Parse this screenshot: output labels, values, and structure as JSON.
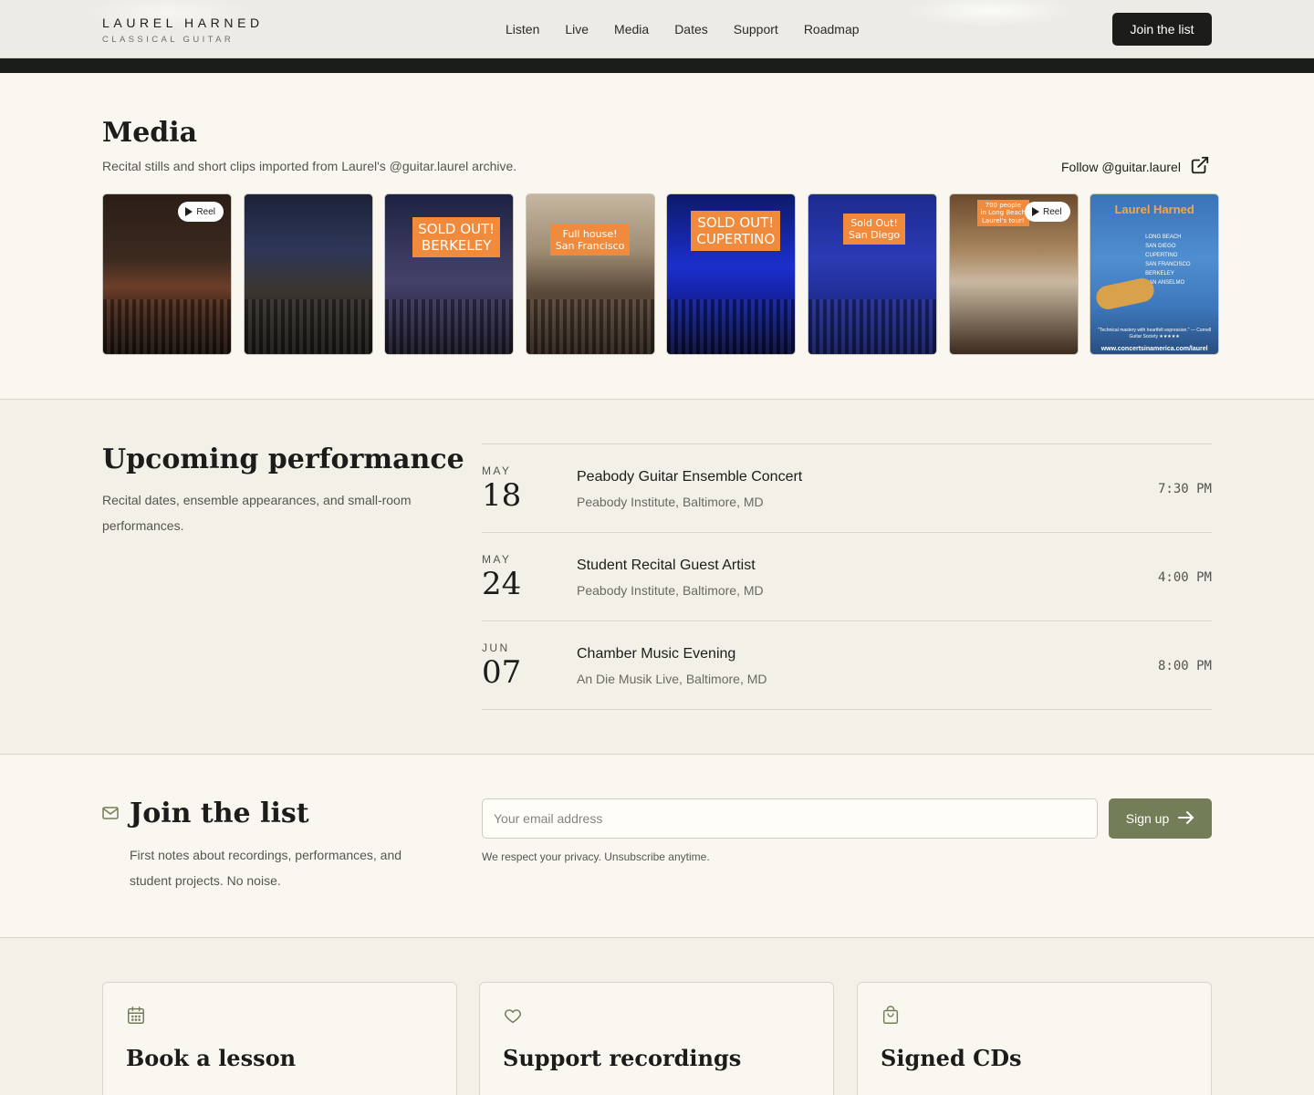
{
  "header": {
    "brand_name": "LAUREL HARNED",
    "brand_sub": "CLASSICAL GUITAR",
    "nav": [
      "Listen",
      "Live",
      "Media",
      "Dates",
      "Support",
      "Roadmap"
    ],
    "cta": "Join the list"
  },
  "media": {
    "title": "Media",
    "subtitle": "Recital stills and short clips imported from Laurel's @guitar.laurel archive.",
    "follow": "Follow @guitar.laurel",
    "reel_label": "Reel",
    "tiles": [
      {
        "tag": ""
      },
      {
        "tag": ""
      },
      {
        "tag_line1": "SOLD OUT!",
        "tag_line2": "BERKELEY"
      },
      {
        "tag_line1": "Full house!",
        "tag_line2": "San Francisco"
      },
      {
        "tag_line1": "SOLD OUT!",
        "tag_line2": "CUPERTINO"
      },
      {
        "tag_line1": "Sold Out!",
        "tag_line2": "San Diego"
      },
      {
        "tag_line1": "700 people",
        "tag_line2": "in Long Beach",
        "tag_line3": "Laurel's tour!"
      },
      {
        "poster_title": "Laurel Harned",
        "poster_list": [
          "LONG BEACH",
          "SAN DIEGO",
          "CUPERTINO",
          "SAN FRANCISCO",
          "BERKELEY",
          "SAN ANSELMO"
        ],
        "poster_quote": "\"Technical mastery with heartfelt expression.\" — Cornell Guitar Society ★★★★★",
        "poster_url": "www.concertsinamerica.com/laurel"
      }
    ]
  },
  "upcoming": {
    "title": "Upcoming performance",
    "description": "Recital dates, ensemble appearances, and small-room performances.",
    "events": [
      {
        "month": "MAY",
        "day": "18",
        "name": "Peabody Guitar Ensemble Concert",
        "venue": "Peabody Institute, Baltimore, MD",
        "time": "7:30 PM"
      },
      {
        "month": "MAY",
        "day": "24",
        "name": "Student Recital Guest Artist",
        "venue": "Peabody Institute, Baltimore, MD",
        "time": "4:00 PM"
      },
      {
        "month": "JUN",
        "day": "07",
        "name": "Chamber Music Evening",
        "venue": "An Die Musik Live, Baltimore, MD",
        "time": "8:00 PM"
      }
    ]
  },
  "join": {
    "title": "Join the list",
    "description": "First notes about recordings, performances, and student projects. No noise.",
    "email_placeholder": "Your email address",
    "signup": "Sign up",
    "privacy": "We respect your privacy. Unsubscribe anytime."
  },
  "cards": [
    {
      "icon": "calendar-icon",
      "title": "Book a lesson"
    },
    {
      "icon": "heart-icon",
      "title": "Support recordings"
    },
    {
      "icon": "shopping-bag-icon",
      "title": "Signed CDs"
    }
  ],
  "colors": {
    "accent_olive": "#737d58",
    "dark": "#1c1c1a",
    "tag_orange": "#f08a3c"
  }
}
